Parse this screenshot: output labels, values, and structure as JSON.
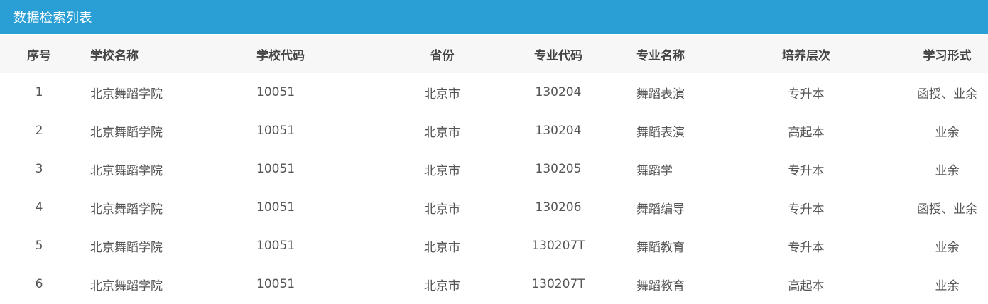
{
  "panel": {
    "title": "数据检索列表"
  },
  "columns": {
    "seq": "序号",
    "school_name": "学校名称",
    "school_code": "学校代码",
    "province": "省份",
    "major_code": "专业代码",
    "major_name": "专业名称",
    "level": "培养层次",
    "study_form": "学习形式"
  },
  "rows": [
    {
      "seq": "1",
      "school_name": "北京舞蹈学院",
      "school_code": "10051",
      "province": "北京市",
      "major_code": "130204",
      "major_name": "舞蹈表演",
      "level": "专升本",
      "study_form": "函授、业余"
    },
    {
      "seq": "2",
      "school_name": "北京舞蹈学院",
      "school_code": "10051",
      "province": "北京市",
      "major_code": "130204",
      "major_name": "舞蹈表演",
      "level": "高起本",
      "study_form": "业余"
    },
    {
      "seq": "3",
      "school_name": "北京舞蹈学院",
      "school_code": "10051",
      "province": "北京市",
      "major_code": "130205",
      "major_name": "舞蹈学",
      "level": "专升本",
      "study_form": "业余"
    },
    {
      "seq": "4",
      "school_name": "北京舞蹈学院",
      "school_code": "10051",
      "province": "北京市",
      "major_code": "130206",
      "major_name": "舞蹈编导",
      "level": "专升本",
      "study_form": "函授、业余"
    },
    {
      "seq": "5",
      "school_name": "北京舞蹈学院",
      "school_code": "10051",
      "province": "北京市",
      "major_code": "130207T",
      "major_name": "舞蹈教育",
      "level": "专升本",
      "study_form": "业余"
    },
    {
      "seq": "6",
      "school_name": "北京舞蹈学院",
      "school_code": "10051",
      "province": "北京市",
      "major_code": "130207T",
      "major_name": "舞蹈教育",
      "level": "高起本",
      "study_form": "业余"
    }
  ],
  "colors": {
    "header_bar": "#2a9fd6",
    "thead_bg": "#f7f7f7"
  }
}
